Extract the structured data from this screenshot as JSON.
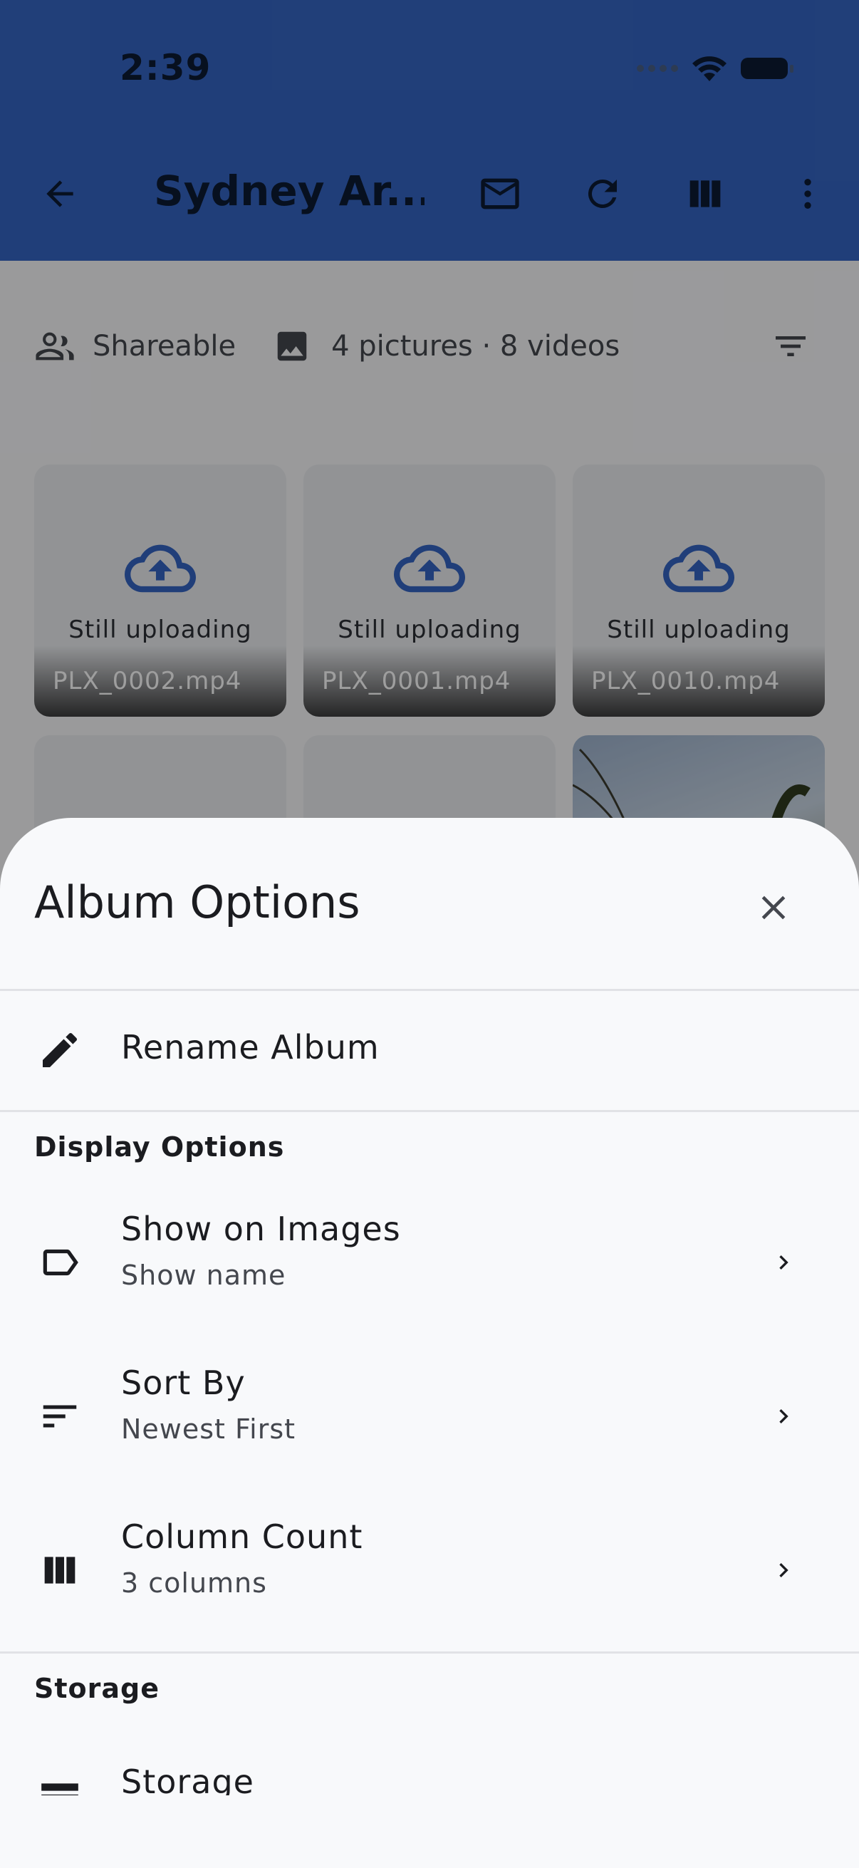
{
  "status_bar": {
    "time": "2:39"
  },
  "app_bar": {
    "title": "Sydney Ar...",
    "icons": [
      "back-arrow-icon",
      "mail-icon",
      "refresh-icon",
      "column-view-icon",
      "more-vertical-icon"
    ]
  },
  "info_bar": {
    "shareable": "Shareable",
    "counts": "4 pictures · 8 videos"
  },
  "grid": {
    "tiles": [
      {
        "status": "Still uploading",
        "filename": "PLX_0002.mp4"
      },
      {
        "status": "Still uploading",
        "filename": "PLX_0001.mp4"
      },
      {
        "status": "Still uploading",
        "filename": "PLX_0010.mp4"
      }
    ]
  },
  "sheet": {
    "title": "Album Options",
    "rename": "Rename Album",
    "display_section": "Display Options",
    "show_on_images": {
      "title": "Show on Images",
      "value": "Show name"
    },
    "sort_by": {
      "title": "Sort By",
      "value": "Newest First"
    },
    "column_count": {
      "title": "Column Count",
      "value": "3 columns"
    },
    "storage_section": "Storage",
    "storage_item": "Storage"
  },
  "colors": {
    "app_bar": "#3565c4",
    "scrim": "rgba(0,0,0,0.38)",
    "sheet_bg": "#f8f9fb"
  }
}
